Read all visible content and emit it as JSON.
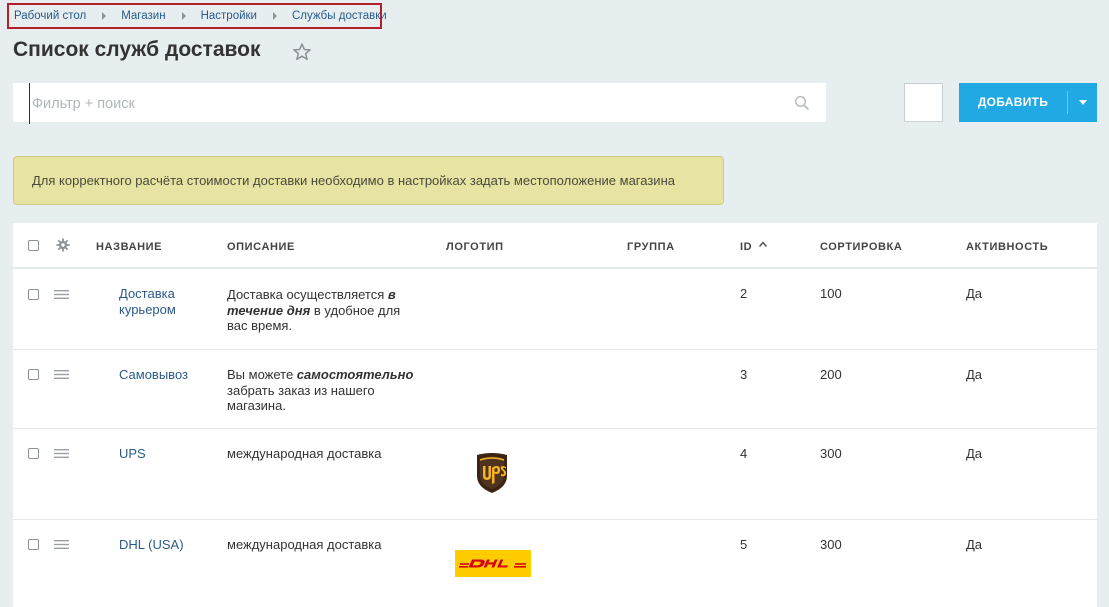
{
  "breadcrumb": [
    "Рабочий стол",
    "Магазин",
    "Настройки",
    "Службы доставки"
  ],
  "page_title": "Список служб доставок",
  "search": {
    "placeholder": "Фильтр + поиск"
  },
  "toolbar": {
    "add_label": "ДОБАВИТЬ"
  },
  "alert": "Для корректного расчёта стоимости доставки необходимо в настройках задать местоположение магазина",
  "table": {
    "columns": [
      "НАЗВАНИЕ",
      "ОПИСАНИЕ",
      "ЛОГОТИП",
      "ГРУППА",
      "ID",
      "СОРТИРОВКА",
      "АКТИВНОСТЬ"
    ],
    "rows": [
      {
        "name": "Доставка курьером",
        "description": [
          "Доставка осуществляется ",
          "в течение дня",
          " в удобное для вас время."
        ],
        "logo": "",
        "group": "",
        "id": "2",
        "sort": "100",
        "active": "Да"
      },
      {
        "name": "Самовывоз",
        "description": [
          "Вы можете ",
          "самостоятельно",
          " забрать заказ из нашего магазина."
        ],
        "logo": "",
        "group": "",
        "id": "3",
        "sort": "200",
        "active": "Да"
      },
      {
        "name": "UPS",
        "description": [
          "международная доставка",
          "",
          ""
        ],
        "logo": "ups",
        "group": "",
        "id": "4",
        "sort": "300",
        "active": "Да"
      },
      {
        "name": "DHL (USA)",
        "description": [
          "международная доставка",
          "",
          ""
        ],
        "logo": "dhl",
        "group": "",
        "id": "5",
        "sort": "300",
        "active": "Да"
      }
    ]
  },
  "colors": {
    "accent": "#20a9e2",
    "link": "#2b5a8a",
    "alert_bg": "#e7e4a3",
    "breadcrumb_highlight": "#b3202a"
  }
}
